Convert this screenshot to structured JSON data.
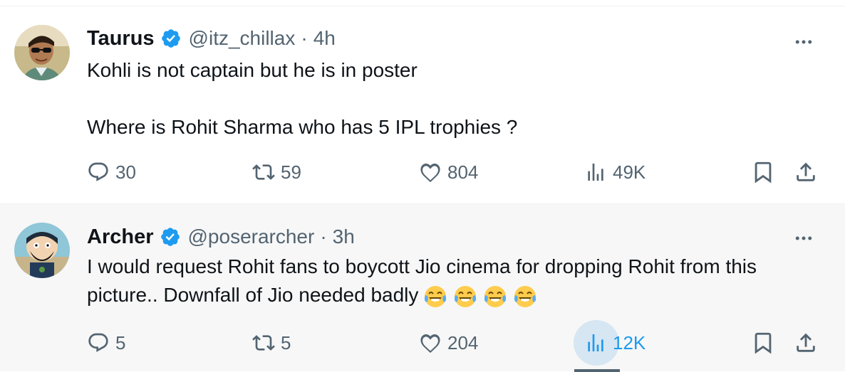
{
  "tweets": [
    {
      "name": "Taurus",
      "handle": "@itz_chillax",
      "separator": "·",
      "time": "4h",
      "text": "Kohli is not captain but he is in poster\n\nWhere is Rohit Sharma who has 5 IPL trophies ?",
      "replies": "30",
      "reposts": "59",
      "likes": "804",
      "views": "49K"
    },
    {
      "name": "Archer",
      "handle": "@poserarcher",
      "separator": "·",
      "time": "3h",
      "text": "I would request Rohit fans to boycott Jio cinema for dropping Rohit from this picture.. Downfall of Jio needed badly",
      "emoji_count": 4,
      "emoji_icon": "face-with-tears-of-joy-icon",
      "replies": "5",
      "reposts": "5",
      "likes": "204",
      "views": "12K"
    }
  ],
  "colors": {
    "text": "#0f1419",
    "secondary": "#536471",
    "verified": "#1d9bf0",
    "highlight": "#1d9bf0",
    "reply_bg": "#f7f7f7"
  },
  "icons": [
    "verified-badge-icon",
    "more-icon",
    "reply-icon",
    "repost-icon",
    "like-icon",
    "views-icon",
    "bookmark-icon",
    "share-icon"
  ]
}
